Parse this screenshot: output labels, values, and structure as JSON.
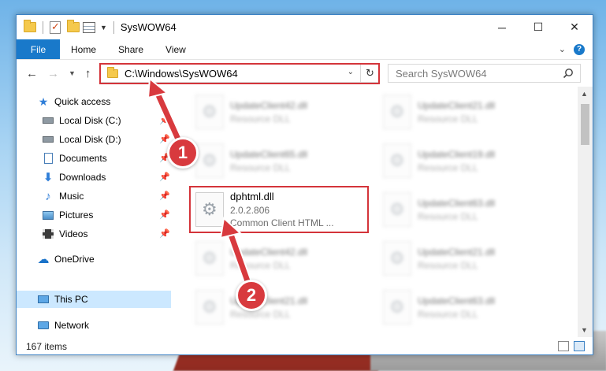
{
  "window": {
    "title": "SysWOW64"
  },
  "ribbon": {
    "file_tab": "File",
    "tabs": [
      "Home",
      "Share",
      "View"
    ]
  },
  "address": {
    "path": "C:\\Windows\\SysWOW64"
  },
  "search": {
    "placeholder": "Search SysWOW64"
  },
  "navpane": {
    "items": [
      {
        "label": "Quick access",
        "icon": "star-icon",
        "pinned": false
      },
      {
        "label": "Local Disk (C:)",
        "icon": "drive-icon",
        "pinned": true
      },
      {
        "label": "Local Disk (D:)",
        "icon": "drive-icon",
        "pinned": true
      },
      {
        "label": "Documents",
        "icon": "documents-icon",
        "pinned": true
      },
      {
        "label": "Downloads",
        "icon": "download-icon",
        "pinned": true
      },
      {
        "label": "Music",
        "icon": "music-icon",
        "pinned": true
      },
      {
        "label": "Pictures",
        "icon": "pictures-icon",
        "pinned": true
      },
      {
        "label": "Videos",
        "icon": "videos-icon",
        "pinned": true
      },
      {
        "label": "OneDrive",
        "icon": "cloud-icon",
        "pinned": false
      },
      {
        "label": "This PC",
        "icon": "computer-icon",
        "pinned": false,
        "selected": true
      },
      {
        "label": "Network",
        "icon": "network-icon",
        "pinned": false
      }
    ]
  },
  "files": {
    "left_column": [
      {
        "name": "UpdateClient42.dll",
        "type": "Resource DLL"
      },
      {
        "name": "UpdateClient65.dll",
        "type": "Resource DLL"
      },
      {
        "name": "UpdateClient42.dll",
        "type": "Resource DLL"
      },
      {
        "name": "UpdateClient21.dll",
        "type": "Resource DLL"
      }
    ],
    "right_column": [
      {
        "name": "UpdateClient21.dll",
        "type": "Resource DLL"
      },
      {
        "name": "UpdateClient19.dll",
        "type": "Resource DLL"
      },
      {
        "name": "UpdateClient63.dll",
        "type": "Resource DLL"
      },
      {
        "name": "UpdateClient21.dll",
        "type": "Resource DLL"
      },
      {
        "name": "UpdateClient63.dll",
        "type": "Resource DLL"
      }
    ],
    "highlighted": {
      "name": "dphtml.dll",
      "version": "2.0.2.806",
      "description": "Common Client HTML ..."
    }
  },
  "status": {
    "item_count": "167 items"
  },
  "callouts": {
    "one": "1",
    "two": "2"
  },
  "colors": {
    "accent": "#1979ca",
    "highlight_red": "#d4343a",
    "callout_red": "#d83a3e",
    "selection": "#cce8ff"
  }
}
